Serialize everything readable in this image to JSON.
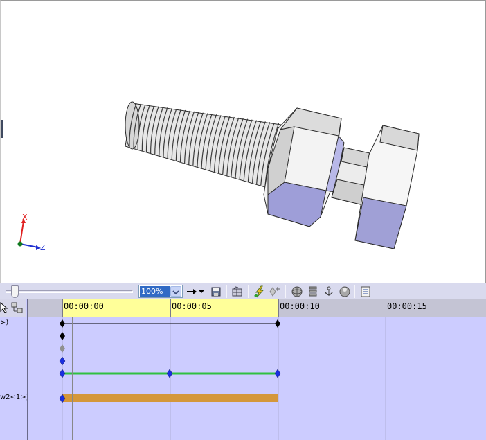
{
  "viewport": {
    "triad": {
      "x_label": "X",
      "z_label": "Z",
      "x_color": "#e02020",
      "z_color": "#2030d0",
      "origin_color": "#107a20"
    },
    "model_colors": {
      "face_light": "#f2f2f2",
      "face_mid": "#d8d8d8",
      "face_shadow": "#a0a0d8",
      "edge": "#2a2a2a"
    }
  },
  "toolbar": {
    "zoom_value": "100%",
    "icons": [
      "arrow-right-icon",
      "dropdown-arrow-icon",
      "save-icon",
      "grid-icon",
      "lightning-key-icon",
      "add-key-icon",
      "sphere-icon",
      "list-stack-icon",
      "anchor-icon",
      "globe-icon",
      "properties-icon"
    ]
  },
  "timeline": {
    "ruler_labels": [
      "00:00:00",
      "00:00:05",
      "00:00:10",
      "00:00:15"
    ],
    "track_labels": [
      ">)",
      "w2<1>)"
    ],
    "highlight_color": "#ffff99",
    "background_color": "#ccccff",
    "colors": {
      "diamond_black": "#000000",
      "diamond_blue": "#1a2ee0",
      "diamond_gray": "#909090",
      "line_green": "#30c040",
      "bar_orange": "#d4973a",
      "cursor": "#888888"
    }
  }
}
